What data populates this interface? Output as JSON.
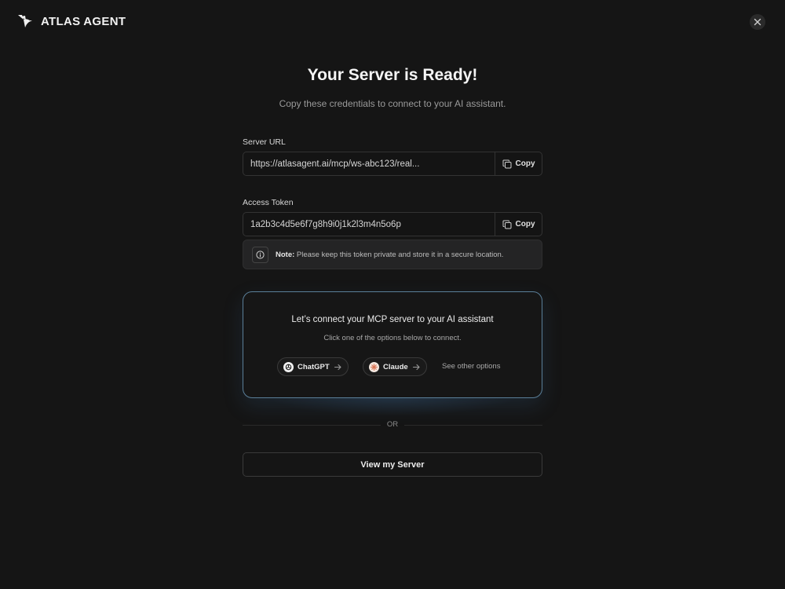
{
  "app": {
    "name": "ATLAS AGENT",
    "logo_icon": "hummingbird-icon"
  },
  "header": {
    "close_icon": "close-icon"
  },
  "main": {
    "title": "Your Server is Ready!",
    "subtitle": "Copy these credentials to connect to your AI assistant."
  },
  "server_url": {
    "label": "Server URL",
    "value": "https://atlasagent.ai/mcp/ws-abc123/real...",
    "copy_label": "Copy"
  },
  "access_token": {
    "label": "Access Token",
    "value": "1a2b3c4d5e6f7g8h9i0j1k2l3m4n5o6p",
    "copy_label": "Copy"
  },
  "note": {
    "prefix": "Note:",
    "text": " Please keep this token private and store it in a secure location."
  },
  "connect": {
    "title": "Let’s connect your MCP server to your AI assistant",
    "subtitle": "Click one of the options below to connect.",
    "options": [
      {
        "label": "ChatGPT",
        "icon": "chatgpt-icon"
      },
      {
        "label": "Claude",
        "icon": "claude-icon"
      }
    ],
    "other_label": "See other options"
  },
  "divider": {
    "label": "OR"
  },
  "view_button": {
    "label": "View my Server"
  },
  "colors": {
    "background": "#151515",
    "card_border": "#5a7f99",
    "claude_accent": "#d97757"
  }
}
